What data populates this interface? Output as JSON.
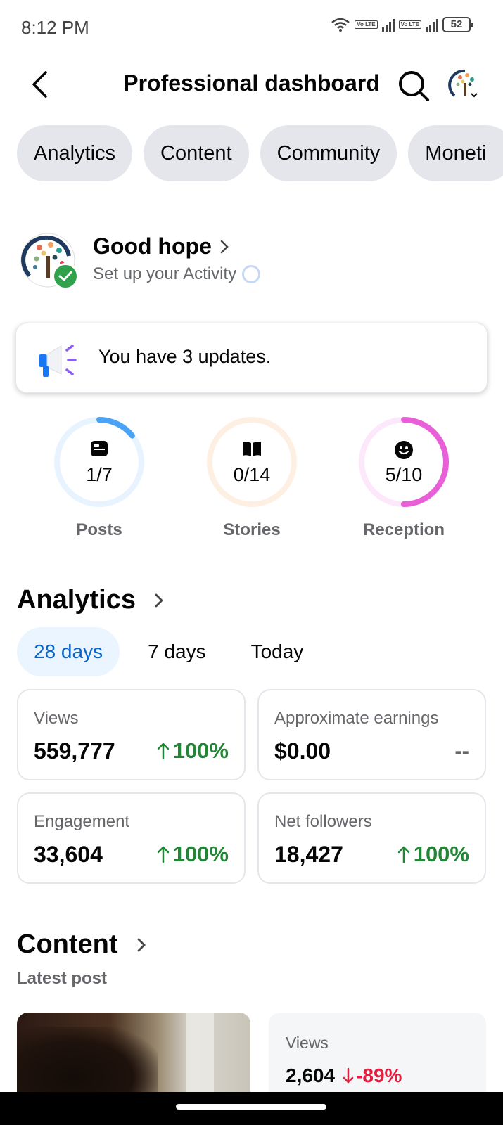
{
  "status_bar": {
    "time": "8:12 PM",
    "battery": "52",
    "volte_label": "Vo LTE"
  },
  "header": {
    "title": "Professional dashboard"
  },
  "tabs": [
    {
      "label": "Analytics"
    },
    {
      "label": "Content"
    },
    {
      "label": "Community"
    },
    {
      "label": "Moneti"
    }
  ],
  "profile": {
    "name": "Good hope",
    "subtitle": "Set up your Activity"
  },
  "updates": {
    "text": "You have 3 updates."
  },
  "progress": [
    {
      "value": "1/7",
      "label": "Posts",
      "fraction": 0.143,
      "color": "#4aa3f5",
      "track": "#e7f3ff"
    },
    {
      "value": "0/14",
      "label": "Stories",
      "fraction": 0,
      "color": "#f7a35c",
      "track": "#fdf0e3"
    },
    {
      "value": "5/10",
      "label": "Reception",
      "fraction": 0.5,
      "color": "#e85fd8",
      "track": "#fce8fa"
    }
  ],
  "analytics": {
    "title": "Analytics",
    "periods": [
      "28 days",
      "7 days",
      "Today"
    ],
    "active_period": "28 days",
    "metrics": [
      {
        "label": "Views",
        "value": "559,777",
        "change": "100%",
        "trend": "up"
      },
      {
        "label": "Approximate earnings",
        "value": "$0.00",
        "change": "--",
        "trend": "none"
      },
      {
        "label": "Engagement",
        "value": "33,604",
        "change": "100%",
        "trend": "up"
      },
      {
        "label": "Net followers",
        "value": "18,427",
        "change": "100%",
        "trend": "up"
      }
    ]
  },
  "content": {
    "title": "Content",
    "subtitle": "Latest post",
    "latest_post": {
      "views_label": "Views",
      "views_value": "2,604",
      "views_change": "-89%",
      "trend": "down"
    }
  },
  "colors": {
    "accent": "#0a65c9",
    "positive": "#238636",
    "negative": "#e41e3f",
    "verified": "#31a24c"
  }
}
